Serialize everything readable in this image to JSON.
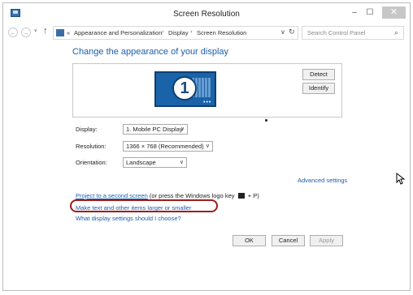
{
  "window": {
    "title": "Screen Resolution",
    "controls": {
      "minimize": "–",
      "maximize": "☐",
      "close": "✕"
    }
  },
  "address_bar": {
    "prefix": "«",
    "breadcrumbs": [
      "Appearance and Personalization",
      "Display",
      "Screen Resolution"
    ],
    "separator": "›",
    "search_placeholder": "Search Control Panel"
  },
  "main": {
    "heading": "Change the appearance of your display",
    "monitor_number": "1",
    "detect_label": "Detect",
    "identify_label": "Identify",
    "display": {
      "label": "Display:",
      "value": "1. Mobile PC Display"
    },
    "resolution": {
      "label": "Resolution:",
      "value": "1366 × 768 (Recommended)"
    },
    "orientation": {
      "label": "Orientation:",
      "value": "Landscape"
    },
    "advanced_settings": "Advanced settings",
    "project_link": "Project to a second screen",
    "project_suffix_before": "(or press the Windows logo key",
    "project_suffix_after": "+ P)",
    "text_size_link": "Make text and other items larger or smaller",
    "help_link": "What display settings should I choose?"
  },
  "buttons": {
    "ok": "OK",
    "cancel": "Cancel",
    "apply": "Apply"
  },
  "colors": {
    "link": "#1e5dab",
    "highlight_ring": "#9e1c1c",
    "monitor": "#1b63a8"
  }
}
